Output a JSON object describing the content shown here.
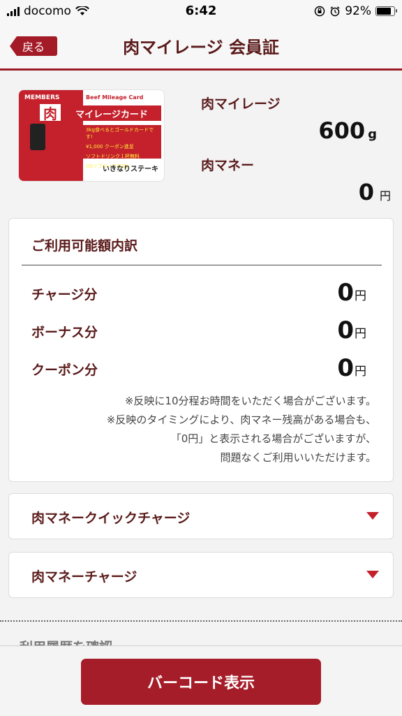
{
  "status_bar": {
    "carrier": "docomo",
    "time": "6:42",
    "battery": "92%"
  },
  "nav": {
    "back_label": "戻る",
    "title": "肉マイレージ 会員証"
  },
  "card": {
    "members": "MEMBERS",
    "beef": "Beef Mileage Card",
    "kanji": "肉",
    "title": "マイレージカード",
    "promo_lines": [
      "3kg食べるとゴールドカードです!",
      "¥1,000 クーポン進呈",
      "ソフトドリンク１杯無料",
      "USリブロース300g"
    ],
    "brand": "いきなりステーキ"
  },
  "summary": {
    "mileage_label": "肉マイレージ",
    "mileage_value": "600",
    "mileage_unit": "g",
    "money_label": "肉マネー",
    "money_value": "0",
    "money_unit": "円"
  },
  "breakdown": {
    "title": "ご利用可能額内訳",
    "rows": [
      {
        "label": "チャージ分",
        "value": "0",
        "unit": "円"
      },
      {
        "label": "ボーナス分",
        "value": "0",
        "unit": "円"
      },
      {
        "label": "クーポン分",
        "value": "0",
        "unit": "円"
      }
    ],
    "notes": [
      "※反映に10分程お時間をいただく場合がございます。",
      "※反映のタイミングにより、肉マネー残高がある場合も、",
      "「0円」と表示される場合がございますが、",
      "問題なくご利用いいただけます。"
    ]
  },
  "accordions": [
    {
      "label": "肉マネークイックチャージ"
    },
    {
      "label": "肉マネーチャージ"
    }
  ],
  "partial_section": "利用履歴を確認",
  "barcode_button": "バーコード表示",
  "colors": {
    "accent": "#a31b27",
    "text": "#5a1a1a"
  }
}
